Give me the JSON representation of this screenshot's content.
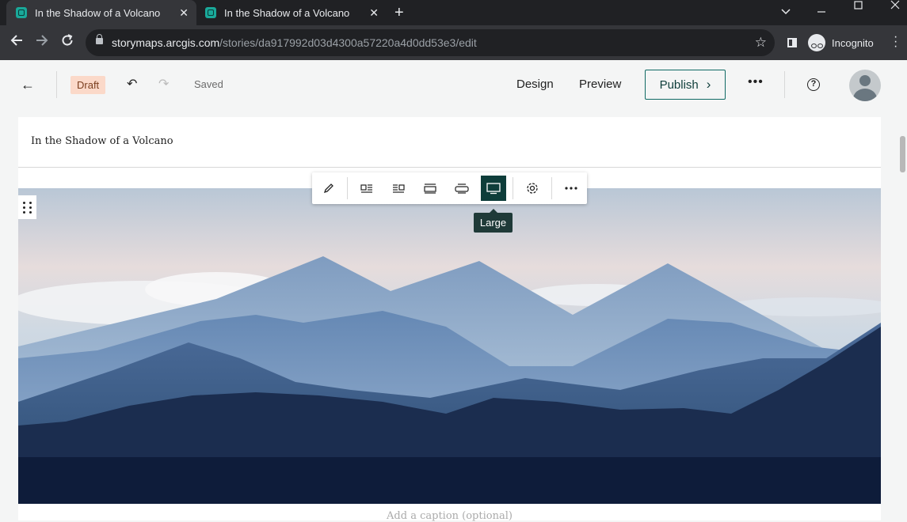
{
  "browser": {
    "tabs": [
      {
        "title": "In the Shadow of a Volcano",
        "active": true
      },
      {
        "title": "In the Shadow of a Volcano",
        "active": false
      }
    ],
    "new_tab_symbol": "+",
    "url_domain": "storymaps.arcgis.com",
    "url_path": "/stories/da917992d03d4300a57220a4d0dd53e3/edit",
    "profile_label": "Incognito"
  },
  "header": {
    "back_symbol": "←",
    "status_badge": "Draft",
    "undo_symbol": "↶",
    "redo_symbol": "↷",
    "save_status": "Saved",
    "design_label": "Design",
    "preview_label": "Preview",
    "publish_label": "Publish",
    "publish_chevron": "›",
    "more_symbol": "•••",
    "help_symbol": "?"
  },
  "story": {
    "title": "In the Shadow of a Volcano",
    "caption_placeholder": "Add a caption (optional)"
  },
  "image_toolbar": {
    "buttons": [
      "edit-icon",
      "float-left-icon",
      "float-right-icon",
      "standard-width-icon",
      "wide-width-icon",
      "large-width-icon",
      "settings-icon",
      "more-icon"
    ],
    "active": "large-width-icon",
    "tooltip": "Large"
  },
  "colors": {
    "accent": "#0e3d3a",
    "draft_badge_bg": "#fbd9c9",
    "tab_favicon": "#1aa99a"
  }
}
